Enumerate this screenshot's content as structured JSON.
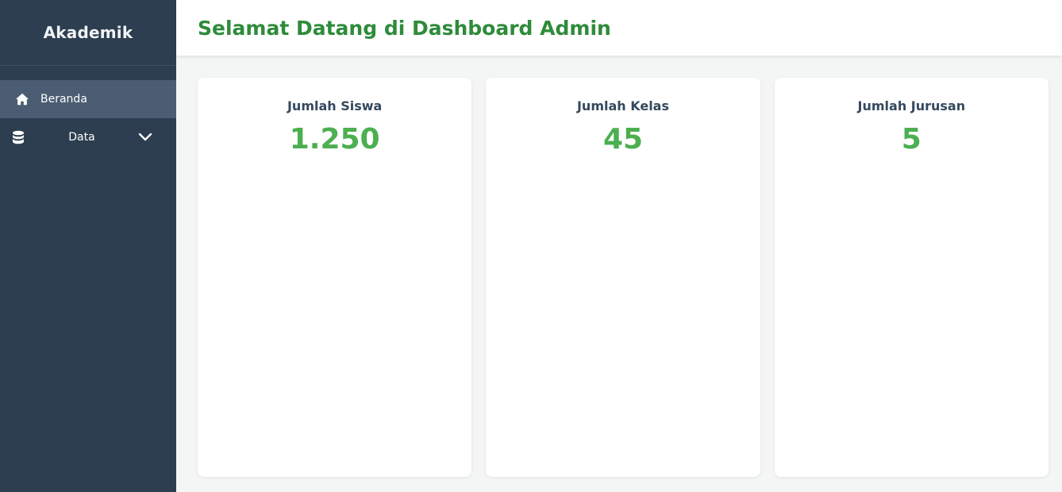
{
  "sidebar": {
    "brand": "Akademik",
    "items": [
      {
        "label": "Beranda",
        "icon": "home-icon",
        "active": true
      },
      {
        "label": "Data",
        "icon": "database-icon",
        "expandable": true
      }
    ]
  },
  "header": {
    "title": "Selamat Datang di Dashboard Admin"
  },
  "cards": [
    {
      "title": "Jumlah Siswa",
      "value": "1.250"
    },
    {
      "title": "Jumlah Kelas",
      "value": "45"
    },
    {
      "title": "Jumlah Jurusan",
      "value": "5"
    }
  ],
  "colors": {
    "sidebar_bg": "#2c3e50",
    "sidebar_active": "#4a5d72",
    "title_green": "#2e8b3a",
    "value_green": "#4caf50",
    "card_title": "#34495e",
    "content_bg": "#f4f6f6"
  }
}
